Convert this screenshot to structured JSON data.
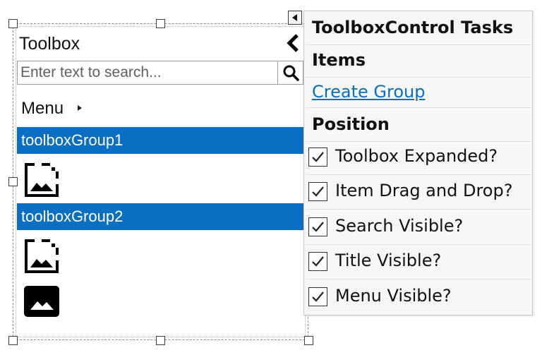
{
  "toolbox": {
    "title": "Toolbox",
    "search": {
      "placeholder": "Enter text to search...",
      "value": ""
    },
    "menu_label": "Menu",
    "groups": [
      {
        "label": "toolboxGroup1",
        "items": [
          {
            "icon": "image-placeholder-icon"
          }
        ]
      },
      {
        "label": "toolboxGroup2",
        "items": [
          {
            "icon": "image-placeholder-icon"
          },
          {
            "icon": "image-filled-icon"
          }
        ]
      }
    ],
    "colors": {
      "group_header_bg": "#0a6fc2",
      "group_header_text": "#ffffff"
    }
  },
  "tasks_panel": {
    "title": "ToolboxControl Tasks",
    "sections": {
      "items_header": "Items",
      "create_group_link": "Create Group",
      "position_header": "Position"
    },
    "options": [
      {
        "label": "Toolbox Expanded?",
        "checked": true
      },
      {
        "label": "Item Drag and Drop?",
        "checked": true
      },
      {
        "label": "Search Visible?",
        "checked": true
      },
      {
        "label": "Title Visible?",
        "checked": true
      },
      {
        "label": "Menu Visible?",
        "checked": true
      }
    ],
    "colors": {
      "link": "#0a6fc2",
      "panel_bg": "#f6f6f6"
    }
  }
}
